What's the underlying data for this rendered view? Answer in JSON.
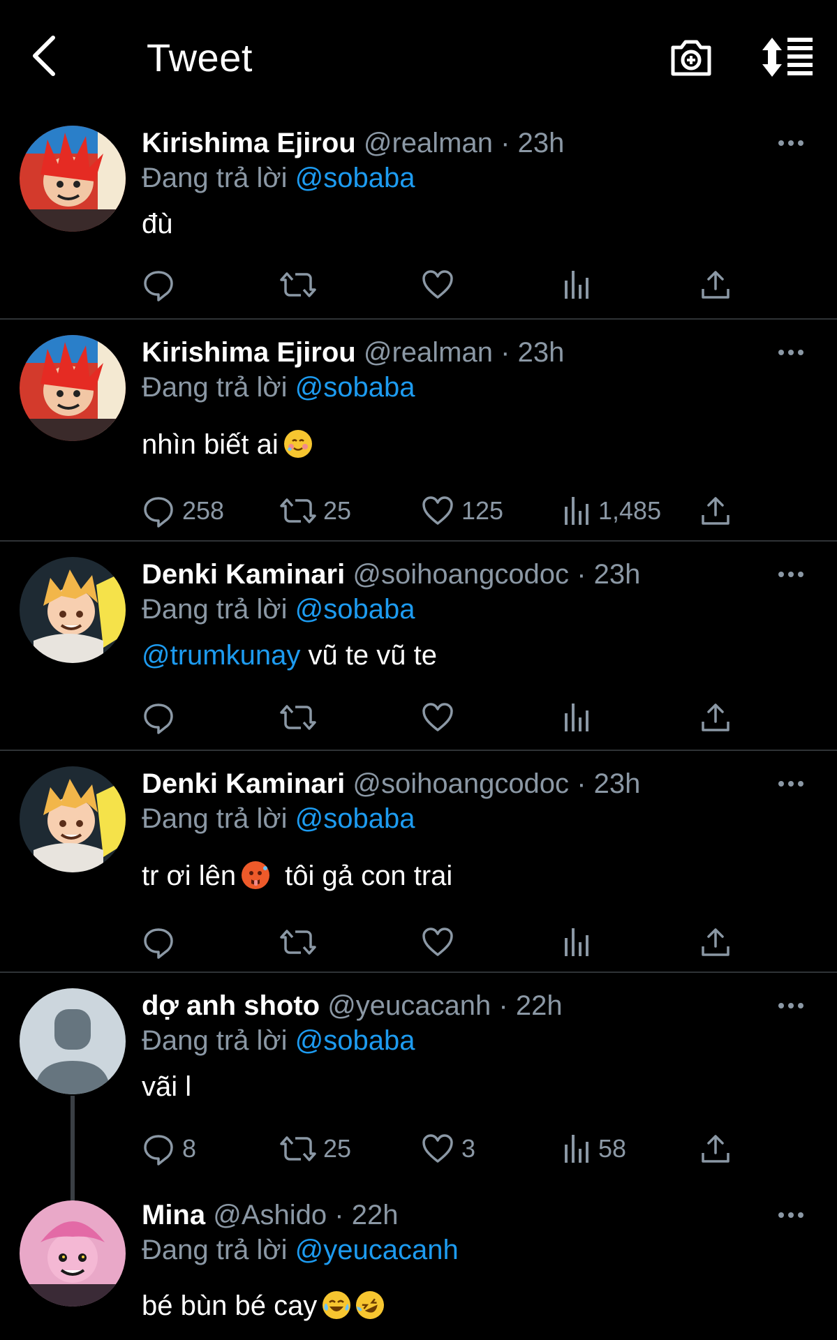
{
  "header": {
    "title": "Tweet",
    "back_icon": "back-arrow-icon",
    "camera_icon": "camera-add-icon",
    "sort_icon": "sort-icon"
  },
  "colors": {
    "background": "#000000",
    "accent": "#1d9bf0",
    "muted": "#8b98a5",
    "divider": "#2f3336"
  },
  "reply_prefix": "Đang trả lời",
  "tweets": [
    {
      "name": "Kirishima Ejirou",
      "handle": "@realman",
      "dot": "·",
      "time": "23h",
      "reply_to": "@sobaba",
      "text": "đù",
      "mention": "",
      "emoji": "",
      "counts": {
        "reply": "",
        "retweet": "",
        "like": "",
        "views": ""
      }
    },
    {
      "name": "Kirishima Ejirou",
      "handle": "@realman",
      "dot": "·",
      "time": "23h",
      "reply_to": "@sobaba",
      "text": "nhìn biết ai",
      "mention": "",
      "emoji": "smiling-face-with-tear-emoji",
      "counts": {
        "reply": "258",
        "retweet": "25",
        "like": "125",
        "views": "1,485"
      }
    },
    {
      "name": "Denki Kaminari",
      "handle": "@soihoangcodoc",
      "dot": "·",
      "time": "23h",
      "reply_to": "@sobaba",
      "text": " vũ te vũ te",
      "mention": "@trumkunay",
      "emoji": "",
      "counts": {
        "reply": "",
        "retweet": "",
        "like": "",
        "views": ""
      }
    },
    {
      "name": "Denki Kaminari",
      "handle": "@soihoangcodoc",
      "dot": "·",
      "time": "23h",
      "reply_to": "@sobaba",
      "text_before": "tr ơi lên",
      "text_after": "tôi gả con trai",
      "emoji": "hot-face-emoji",
      "counts": {
        "reply": "",
        "retweet": "",
        "like": "",
        "views": ""
      }
    },
    {
      "name": "dợ anh shoto",
      "handle": "@yeucacanh",
      "dot": "·",
      "time": "22h",
      "reply_to": "@sobaba",
      "text": "vãi l",
      "mention": "",
      "emoji": "",
      "counts": {
        "reply": "8",
        "retweet": "25",
        "like": "3",
        "views": "58"
      }
    },
    {
      "name": "Mina",
      "handle": "@Ashido",
      "dot": "·",
      "time": "22h",
      "reply_to": "@yeucacanh",
      "text": "bé bùn bé cay",
      "mention": "",
      "emoji": "tears-of-joy-emoji rolling-laughing-emoji",
      "counts": {
        "reply": "",
        "retweet": "",
        "like": "",
        "views": ""
      }
    }
  ]
}
